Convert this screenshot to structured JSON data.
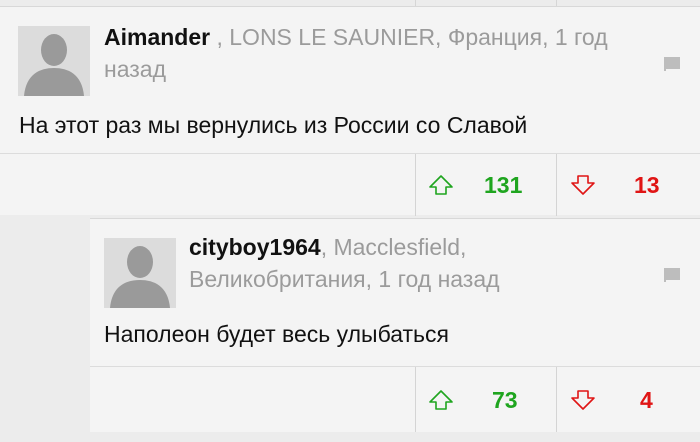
{
  "comments": [
    {
      "author": "Aimander",
      "meta_line1": " , LONS LE SAUNIER, Франция, 1 год",
      "meta_line2": "назад",
      "text": "На этот раз мы вернулись из России со Славой",
      "upvotes": "131",
      "downvotes": "13"
    },
    {
      "author": "cityboy1964",
      "meta_line1": ", Macclesfield,",
      "meta_line2": "Великобритания, 1 год назад",
      "text": "Наполеон будет весь улыбаться",
      "upvotes": "73",
      "downvotes": "4"
    }
  ],
  "colors": {
    "upvote": "#1fa51f",
    "downvote": "#e01515"
  },
  "icons": [
    "avatar-placeholder-icon",
    "flag-icon",
    "arrow-up-icon",
    "arrow-down-icon"
  ]
}
